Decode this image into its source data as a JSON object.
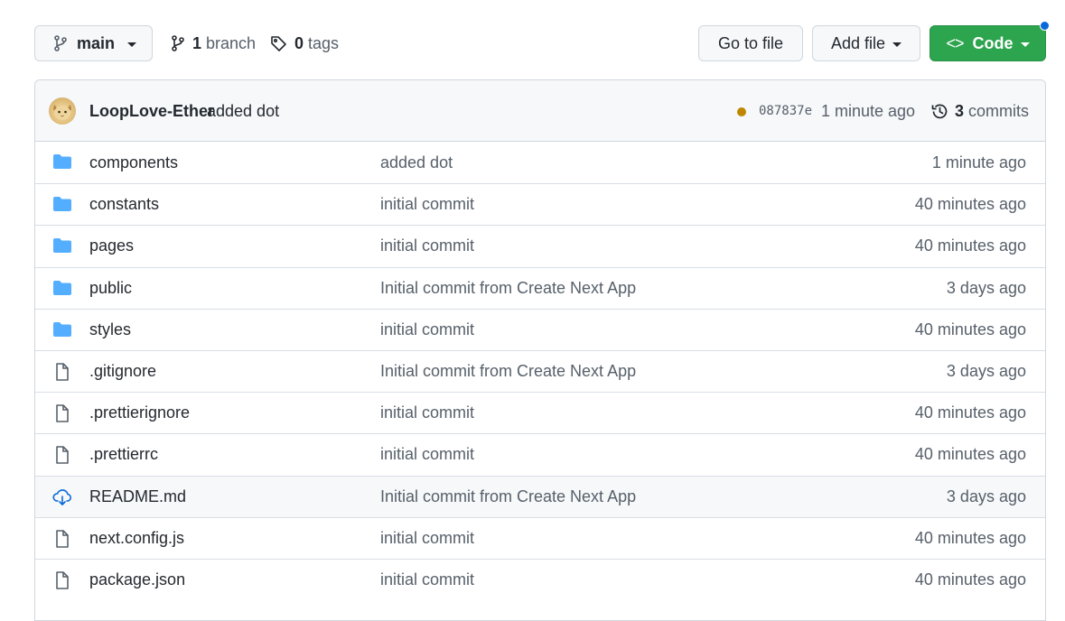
{
  "toolbar": {
    "branch_selector": "main",
    "branch_count": "1",
    "branch_label": "branch",
    "tag_count": "0",
    "tag_label": "tags",
    "goto_file_label": "Go to file",
    "add_file_label": "Add file",
    "code_label": "Code",
    "code_glyph": "<>"
  },
  "latest_commit": {
    "author": "LoopLove-Ether",
    "message": "added dot",
    "sha": "087837e",
    "time": "1 minute ago",
    "commit_count": "3",
    "commit_label": "commits",
    "status_color": "#bf8700"
  },
  "files": [
    {
      "type": "directory",
      "icon": "folder-icon",
      "name": "components",
      "commit": "added dot",
      "age": "1 minute ago"
    },
    {
      "type": "directory",
      "icon": "folder-icon",
      "name": "constants",
      "commit": "initial commit",
      "age": "40 minutes ago"
    },
    {
      "type": "directory",
      "icon": "folder-icon",
      "name": "pages",
      "commit": "initial commit",
      "age": "40 minutes ago"
    },
    {
      "type": "directory",
      "icon": "folder-icon",
      "name": "public",
      "commit": "Initial commit from Create Next App",
      "age": "3 days ago"
    },
    {
      "type": "directory",
      "icon": "folder-icon",
      "name": "styles",
      "commit": "initial commit",
      "age": "40 minutes ago"
    },
    {
      "type": "file",
      "icon": "file-icon",
      "name": ".gitignore",
      "commit": "Initial commit from Create Next App",
      "age": "3 days ago"
    },
    {
      "type": "file",
      "icon": "file-icon",
      "name": ".prettierignore",
      "commit": "initial commit",
      "age": "40 minutes ago"
    },
    {
      "type": "file",
      "icon": "file-icon",
      "name": ".prettierrc",
      "commit": "initial commit",
      "age": "40 minutes ago"
    },
    {
      "type": "file",
      "icon": "download-icon",
      "name": "README.md",
      "commit": "Initial commit from Create Next App",
      "age": "3 days ago",
      "hovered": true
    },
    {
      "type": "file",
      "icon": "file-icon",
      "name": "next.config.js",
      "commit": "initial commit",
      "age": "40 minutes ago"
    },
    {
      "type": "file",
      "icon": "file-icon",
      "name": "package.json",
      "commit": "initial commit",
      "age": "40 minutes ago"
    }
  ],
  "colors": {
    "folder": "#54aeff",
    "code_button": "#2da44e",
    "accent": "#0969da"
  }
}
